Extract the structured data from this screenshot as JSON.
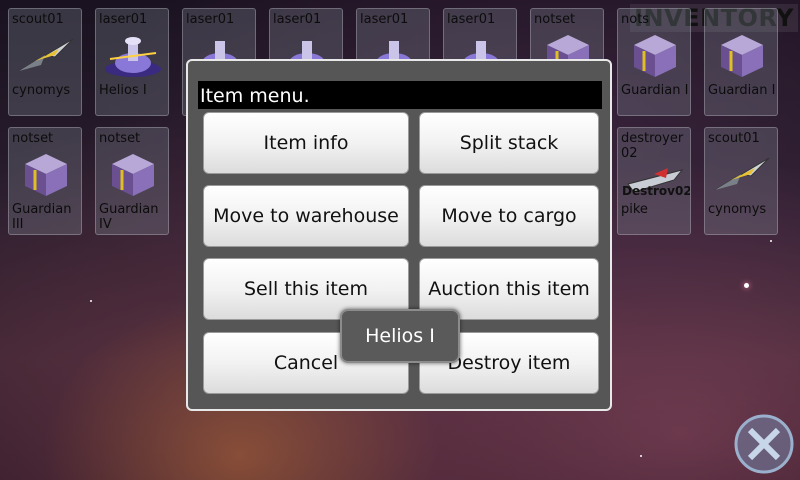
{
  "screen": {
    "title": "INVENTORY"
  },
  "inventory": {
    "row1": [
      {
        "code": "scout01",
        "name": "cynomys",
        "icon": "ship-icon"
      },
      {
        "code": "laser01",
        "name": "Helios I",
        "icon": "laser-icon"
      },
      {
        "code": "laser01",
        "name": "",
        "icon": "laser-icon"
      },
      {
        "code": "laser01",
        "name": "",
        "icon": "laser-icon"
      },
      {
        "code": "laser01",
        "name": "",
        "icon": "laser-icon"
      },
      {
        "code": "laser01",
        "name": "",
        "icon": "laser-icon"
      },
      {
        "code": "notset",
        "name": "",
        "icon": "cube-icon"
      },
      {
        "code": "nots",
        "name": "Guardian I",
        "icon": "cube-icon"
      },
      {
        "code": "",
        "name": "Guardian I",
        "icon": "cube-icon"
      }
    ],
    "row2": [
      {
        "code": "notset",
        "name": "Guardian III",
        "icon": "cube-icon"
      },
      {
        "code": "notset",
        "name": "Guardian IV",
        "icon": "cube-icon"
      },
      {
        "code": "destroyer 02",
        "name": "pike",
        "overlay": "Destrov02",
        "icon": "ship-icon"
      },
      {
        "code": "scout01",
        "name": "cynomys",
        "icon": "ship-icon"
      }
    ]
  },
  "dialog": {
    "title": "Item menu.",
    "buttons": {
      "item_info": "Item info",
      "split_stack": "Split stack",
      "move_warehouse": "Move to warehouse",
      "move_cargo": "Move to cargo",
      "sell": "Sell this item",
      "auction": "Auction this item",
      "cancel": "Cancel",
      "destroy": "Destroy item"
    }
  },
  "toast": {
    "text": "Helios I"
  },
  "colors": {
    "dialog_bg": "#565656",
    "title_bar": "#000000",
    "button_bg": "#f2f2f2"
  }
}
